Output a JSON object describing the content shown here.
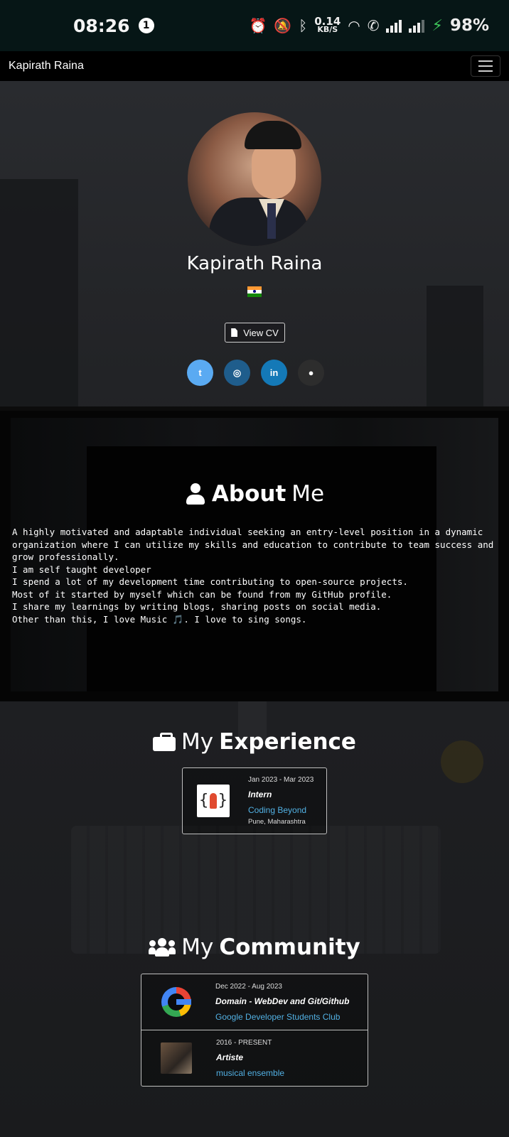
{
  "statusbar": {
    "time": "08:26",
    "notification_count": "1",
    "net_speed_value": "0.14",
    "net_speed_unit": "KB/S",
    "battery": "98%"
  },
  "navbar": {
    "brand": "Kapirath Raina"
  },
  "profile": {
    "name": "Kapirath Raina",
    "cv_label": "View CV",
    "socials": [
      {
        "icon": "twitter-icon",
        "glyph": "t"
      },
      {
        "icon": "instagram-icon",
        "glyph": "◎"
      },
      {
        "icon": "linkedin-icon",
        "glyph": "in"
      },
      {
        "icon": "github-icon",
        "glyph": "●"
      }
    ]
  },
  "about": {
    "title_bold": "About",
    "title_light": "Me",
    "lines": [
      "A highly motivated and adaptable individual seeking an entry-level position in a dynamic organization where I can utilize my skills and education to contribute to team success and grow professionally.",
      "I am self taught developer",
      "I spend a lot of my development time contributing to open-source projects.",
      "Most of it started by myself which can be found from my GitHub profile.",
      "I share my learnings by writing blogs, sharing posts on social media.",
      "Other than this, I love Music 🎵. I love to sing songs."
    ]
  },
  "experience": {
    "title_light": "My",
    "title_bold": "Experience",
    "items": [
      {
        "date": "Jan 2023 - Mar 2023",
        "role": "Intern",
        "org": "Coding Beyond",
        "location": "Pune, Maharashtra"
      }
    ]
  },
  "community": {
    "title_light": "My",
    "title_bold": "Community",
    "items": [
      {
        "date": "Dec 2022 - Aug 2023",
        "role": "Domain - WebDev and Git/Github",
        "org": "Google Developer Students Club"
      },
      {
        "date": "2016 - PRESENT",
        "role": "Artiste",
        "org": "musical ensemble"
      }
    ]
  },
  "colors": {
    "link": "#52b1e4",
    "twitter": "#5aaaf2",
    "instagram": "#1f5d8c",
    "linkedin": "#1479b7",
    "github": "#2d2d2d"
  }
}
